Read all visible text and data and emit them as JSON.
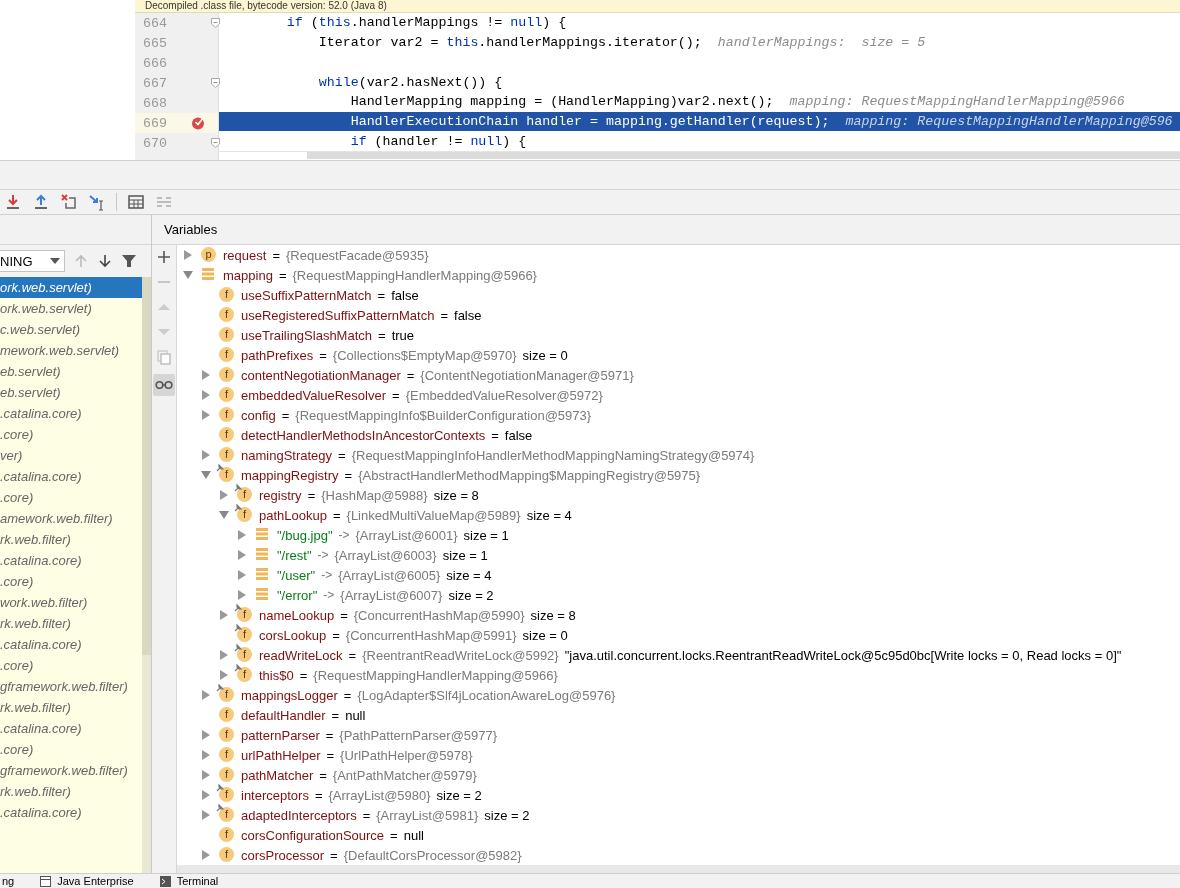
{
  "editor": {
    "banner": "Decompiled .class file, bytecode version: 52.0 (Java 8)",
    "lines": [
      {
        "number": "664",
        "tokens": [
          {
            "text": "        if",
            "kind": "keyword"
          },
          {
            "text": " (",
            "kind": "plain"
          },
          {
            "text": "this",
            "kind": "keyword"
          },
          {
            "text": ".handlerMappings != ",
            "kind": "plain"
          },
          {
            "text": "null",
            "kind": "keyword"
          },
          {
            "text": ") {",
            "kind": "plain"
          }
        ],
        "fold": true,
        "breakpoint": false,
        "current": false
      },
      {
        "number": "665",
        "tokens": [
          {
            "text": "            Iterator var2 = ",
            "kind": "plain"
          },
          {
            "text": "this",
            "kind": "keyword"
          },
          {
            "text": ".handlerMappings.iterator();",
            "kind": "plain"
          }
        ],
        "hint": "handlerMappings:  size = 5",
        "fold": false,
        "breakpoint": false,
        "current": false
      },
      {
        "number": "666",
        "fold": false,
        "breakpoint": false,
        "current": false
      },
      {
        "number": "667",
        "tokens": [
          {
            "text": "            while",
            "kind": "keyword"
          },
          {
            "text": "(var2.hasNext()) {",
            "kind": "plain"
          }
        ],
        "fold": true,
        "breakpoint": false,
        "current": false
      },
      {
        "number": "668",
        "tokens": [
          {
            "text": "                HandlerMapping mapping = (HandlerMapping)var2.next();",
            "kind": "plain"
          }
        ],
        "hint": "mapping: RequestMappingHandlerMapping@5966",
        "fold": false,
        "breakpoint": false,
        "current": false
      },
      {
        "number": "669",
        "tokens": [
          {
            "text": "                HandlerExecutionChain handler = mapping.getHandler(request);",
            "kind": "plain"
          }
        ],
        "hint": "mapping: RequestMappingHandlerMapping@596",
        "fold": false,
        "breakpoint": true,
        "current": true
      },
      {
        "number": "670",
        "tokens": [
          {
            "text": "                if",
            "kind": "keyword"
          },
          {
            "text": " (handler != ",
            "kind": "plain"
          },
          {
            "text": "null",
            "kind": "keyword"
          },
          {
            "text": ") {",
            "kind": "plain"
          }
        ],
        "fold": true,
        "breakpoint": false,
        "current": false
      }
    ]
  },
  "frames": {
    "filter": "NING",
    "items": [
      {
        "text": "ork.web.servlet)",
        "selected": true
      },
      {
        "text": "ork.web.servlet)",
        "selected": false
      },
      {
        "text": "c.web.servlet)",
        "selected": false
      },
      {
        "text": "mework.web.servlet)",
        "selected": false
      },
      {
        "text": "eb.servlet)",
        "selected": false
      },
      {
        "text": "eb.servlet)",
        "selected": false
      },
      {
        "text": ".catalina.core)",
        "selected": false
      },
      {
        "text": ".core)",
        "selected": false
      },
      {
        "text": "ver)",
        "selected": false
      },
      {
        "text": ".catalina.core)",
        "selected": false
      },
      {
        "text": ".core)",
        "selected": false
      },
      {
        "text": "amework.web.filter)",
        "selected": false
      },
      {
        "text": "rk.web.filter)",
        "selected": false
      },
      {
        "text": ".catalina.core)",
        "selected": false
      },
      {
        "text": ".core)",
        "selected": false
      },
      {
        "text": "work.web.filter)",
        "selected": false
      },
      {
        "text": "rk.web.filter)",
        "selected": false
      },
      {
        "text": ".catalina.core)",
        "selected": false
      },
      {
        "text": ".core)",
        "selected": false
      },
      {
        "text": "gframework.web.filter)",
        "selected": false
      },
      {
        "text": "rk.web.filter)",
        "selected": false
      },
      {
        "text": ".catalina.core)",
        "selected": false
      },
      {
        "text": ".core)",
        "selected": false
      },
      {
        "text": "gframework.web.filter)",
        "selected": false
      },
      {
        "text": "rk.web.filter)",
        "selected": false
      },
      {
        "text": ".catalina.core)",
        "selected": false
      }
    ]
  },
  "variables": {
    "title": "Variables",
    "items": [
      {
        "kind": "param",
        "letter": "p",
        "name": "request",
        "op": "=",
        "ref": "{RequestFacade@5935}",
        "expanded": false,
        "final": false
      },
      {
        "kind": "local",
        "name": "mapping",
        "op": "=",
        "ref": "{RequestMappingHandlerMapping@5966}",
        "expanded": true,
        "final": false,
        "children": [
          {
            "kind": "field",
            "letter": "f",
            "name": "useSuffixPatternMatch",
            "op": "=",
            "extra": "false",
            "final": false
          },
          {
            "kind": "field",
            "letter": "f",
            "name": "useRegisteredSuffixPatternMatch",
            "op": "=",
            "extra": "false",
            "final": false
          },
          {
            "kind": "field",
            "letter": "f",
            "name": "useTrailingSlashMatch",
            "op": "=",
            "extra": "true",
            "final": false
          },
          {
            "kind": "field",
            "letter": "f",
            "name": "pathPrefixes",
            "op": "=",
            "ref": "{Collections$EmptyMap@5970}",
            "extra": "size = 0",
            "final": false
          },
          {
            "kind": "field",
            "letter": "f",
            "name": "contentNegotiationManager",
            "op": "=",
            "ref": "{ContentNegotiationManager@5971}",
            "expanded": false,
            "final": false
          },
          {
            "kind": "field",
            "letter": "f",
            "name": "embeddedValueResolver",
            "op": "=",
            "ref": "{EmbeddedValueResolver@5972}",
            "expanded": false,
            "final": false
          },
          {
            "kind": "field",
            "letter": "f",
            "name": "config",
            "op": "=",
            "ref": "{RequestMappingInfo$BuilderConfiguration@5973}",
            "expanded": false,
            "final": false
          },
          {
            "kind": "field",
            "letter": "f",
            "name": "detectHandlerMethodsInAncestorContexts",
            "op": "=",
            "extra": "false",
            "final": false
          },
          {
            "kind": "field",
            "letter": "f",
            "name": "namingStrategy",
            "op": "=",
            "ref": "{RequestMappingInfoHandlerMethodMappingNamingStrategy@5974}",
            "expanded": false,
            "final": false
          },
          {
            "kind": "field",
            "letter": "f",
            "name": "mappingRegistry",
            "op": "=",
            "ref": "{AbstractHandlerMethodMapping$MappingRegistry@5975}",
            "expanded": true,
            "final": true,
            "children": [
              {
                "kind": "field",
                "letter": "f",
                "name": "registry",
                "op": "=",
                "ref": "{HashMap@5988}",
                "extra": "size = 8",
                "expanded": false,
                "final": true
              },
              {
                "kind": "field",
                "letter": "f",
                "name": "pathLookup",
                "op": "=",
                "ref": "{LinkedMultiValueMap@5989}",
                "extra": "size = 4",
                "expanded": true,
                "final": true,
                "children": [
                  {
                    "kind": "entry",
                    "name": "\"/bug.jpg\"",
                    "op": "->",
                    "ref": "{ArrayList@6001}",
                    "extra": "size = 1",
                    "expanded": false,
                    "final": false
                  },
                  {
                    "kind": "entry",
                    "name": "\"/rest\"",
                    "op": "->",
                    "ref": "{ArrayList@6003}",
                    "extra": "size = 1",
                    "expanded": false,
                    "final": false
                  },
                  {
                    "kind": "entry",
                    "name": "\"/user\"",
                    "op": "->",
                    "ref": "{ArrayList@6005}",
                    "extra": "size = 4",
                    "expanded": false,
                    "final": false
                  },
                  {
                    "kind": "entry",
                    "name": "\"/error\"",
                    "op": "->",
                    "ref": "{ArrayList@6007}",
                    "extra": "size = 2",
                    "expanded": false,
                    "final": false
                  }
                ]
              },
              {
                "kind": "field",
                "letter": "f",
                "name": "nameLookup",
                "op": "=",
                "ref": "{ConcurrentHashMap@5990}",
                "extra": "size = 8",
                "expanded": false,
                "final": true
              },
              {
                "kind": "field",
                "letter": "f",
                "name": "corsLookup",
                "op": "=",
                "ref": "{ConcurrentHashMap@5991}",
                "extra": "size = 0",
                "final": true
              },
              {
                "kind": "field",
                "letter": "f",
                "name": "readWriteLock",
                "op": "=",
                "ref": "{ReentrantReadWriteLock@5992}",
                "extra": "\"java.util.concurrent.locks.ReentrantReadWriteLock@5c95d0bc[Write locks = 0, Read locks = 0]\"",
                "expanded": false,
                "final": true
              },
              {
                "kind": "field",
                "letter": "f",
                "name": "this$0",
                "op": "=",
                "ref": "{RequestMappingHandlerMapping@5966}",
                "expanded": false,
                "final": true
              }
            ]
          },
          {
            "kind": "field",
            "letter": "f",
            "name": "mappingsLogger",
            "op": "=",
            "ref": "{LogAdapter$Slf4jLocationAwareLog@5976}",
            "expanded": false,
            "final": true
          },
          {
            "kind": "field",
            "letter": "f",
            "name": "defaultHandler",
            "op": "=",
            "extra": "null",
            "final": false
          },
          {
            "kind": "field",
            "letter": "f",
            "name": "patternParser",
            "op": "=",
            "ref": "{PathPatternParser@5977}",
            "expanded": false,
            "final": false
          },
          {
            "kind": "field",
            "letter": "f",
            "name": "urlPathHelper",
            "op": "=",
            "ref": "{UrlPathHelper@5978}",
            "expanded": false,
            "final": false
          },
          {
            "kind": "field",
            "letter": "f",
            "name": "pathMatcher",
            "op": "=",
            "ref": "{AntPathMatcher@5979}",
            "expanded": false,
            "final": false
          },
          {
            "kind": "field",
            "letter": "f",
            "name": "interceptors",
            "op": "=",
            "ref": "{ArrayList@5980}",
            "extra": "size = 2",
            "expanded": false,
            "final": true
          },
          {
            "kind": "field",
            "letter": "f",
            "name": "adaptedInterceptors",
            "op": "=",
            "ref": "{ArrayList@5981}",
            "extra": "size = 2",
            "expanded": false,
            "final": true
          },
          {
            "kind": "field",
            "letter": "f",
            "name": "corsConfigurationSource",
            "op": "=",
            "extra": "null",
            "final": false
          },
          {
            "kind": "field",
            "letter": "f",
            "name": "corsProcessor",
            "op": "=",
            "ref": "{DefaultCorsProcessor@5982}",
            "expanded": false,
            "final": false
          }
        ]
      }
    ]
  },
  "bottom_tabs": [
    {
      "label": "ng",
      "has_icon": false
    },
    {
      "label": "Java Enterprise",
      "has_icon": true
    },
    {
      "label": "Terminal",
      "has_icon": true
    }
  ]
}
